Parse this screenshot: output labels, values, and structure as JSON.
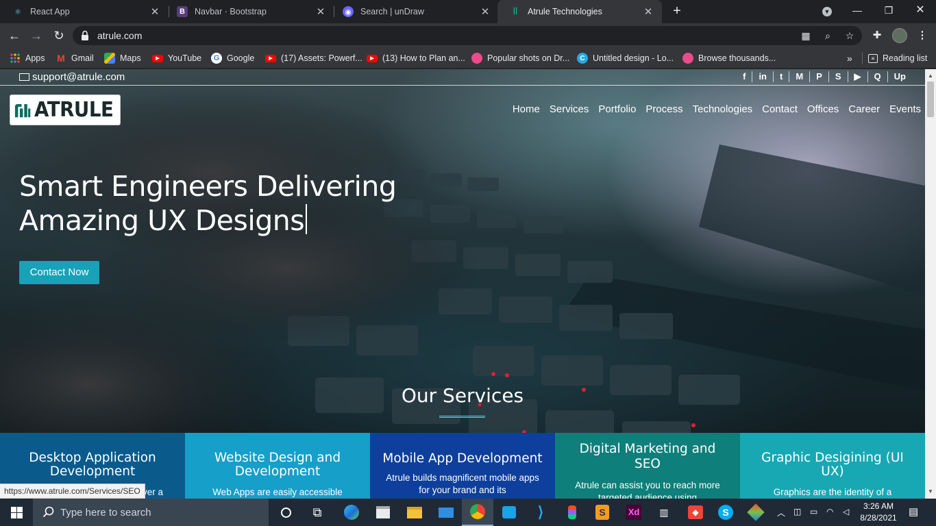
{
  "browser": {
    "tabs": [
      {
        "title": "React App",
        "icon": "react-icon"
      },
      {
        "title": "Navbar · Bootstrap",
        "icon": "bootstrap-icon"
      },
      {
        "title": "Search | unDraw",
        "icon": "undraw-icon"
      },
      {
        "title": "Atrule Technologies",
        "icon": "atrule-icon",
        "active": true
      }
    ],
    "url": "atrule.com",
    "bookmarks": [
      {
        "label": "Apps",
        "icon": "apps-grid-icon"
      },
      {
        "label": "Gmail",
        "icon": "gmail-icon"
      },
      {
        "label": "Maps",
        "icon": "maps-icon"
      },
      {
        "label": "YouTube",
        "icon": "youtube-icon"
      },
      {
        "label": "Google",
        "icon": "google-icon"
      },
      {
        "label": "(17) Assets: Powerf...",
        "icon": "youtube-icon"
      },
      {
        "label": "(13) How to Plan an...",
        "icon": "youtube-icon"
      },
      {
        "label": "Popular shots on Dr...",
        "icon": "dribbble-icon"
      },
      {
        "label": "Untitled design - Lo...",
        "icon": "canva-icon"
      },
      {
        "label": "Browse thousands...",
        "icon": "dribbble-icon"
      }
    ],
    "more_bookmarks": "»",
    "reading_list": "Reading list"
  },
  "page": {
    "support_email": "support@atrule.com",
    "social": [
      "f",
      "in",
      "t",
      "M",
      "P",
      "S",
      "▶",
      "Q",
      "Up"
    ],
    "logo_text": "ATRULE",
    "nav": [
      "Home",
      "Services",
      "Portfolio",
      "Process",
      "Technologies",
      "Contact",
      "Offices",
      "Career",
      "Events"
    ],
    "hero_line1": "Smart Engineers Delivering",
    "hero_line2": "Amazing UX Designs",
    "cta": "Contact Now",
    "services_title": "Our Services",
    "services": [
      {
        "title": "Desktop Application Development",
        "text": "ver a",
        "color": "#0a5a8c"
      },
      {
        "title": "Website Design and Development",
        "text": "Web Apps are easily accessible",
        "color": "#169fc8"
      },
      {
        "title": "Mobile App Development",
        "text": "Atrule builds magnificent mobile apps for your brand and its",
        "color": "#0e3f9c"
      },
      {
        "title": "Digital Marketing and SEO",
        "text": "Atrule can assist you to reach more targeted audience using",
        "color": "#0e7f7a"
      },
      {
        "title": "Graphic Desigining (UI UX)",
        "text": "Graphics are the identity of a",
        "color": "#17a8b3"
      }
    ]
  },
  "status_url": "https://www.atrule.com/Services/SEO",
  "taskbar": {
    "search_placeholder": "Type here to search",
    "time": "3:26 AM",
    "date": "8/28/2021"
  }
}
